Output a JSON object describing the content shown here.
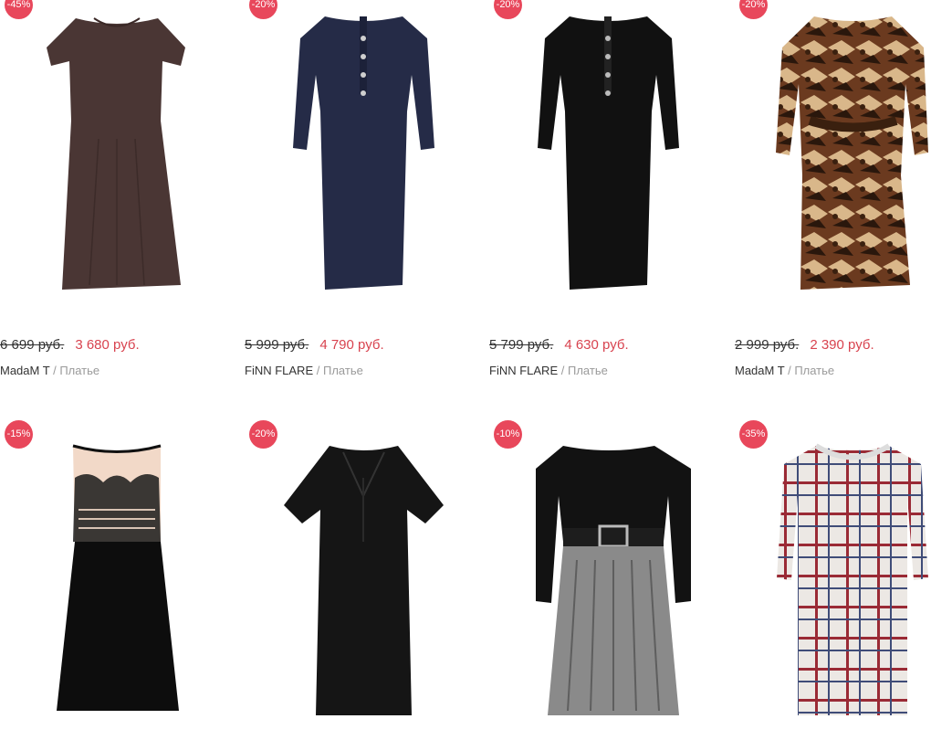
{
  "products": [
    {
      "badge": "-45%",
      "old_price": "6 699 руб.",
      "new_price": "3 680 руб.",
      "brand": "MadaM T",
      "category": "Платье"
    },
    {
      "badge": "-20%",
      "old_price": "5 999 руб.",
      "new_price": "4 790 руб.",
      "brand": "FiNN FLARE",
      "category": "Платье"
    },
    {
      "badge": "-20%",
      "old_price": "5 799 руб.",
      "new_price": "4 630 руб.",
      "brand": "FiNN FLARE",
      "category": "Платье"
    },
    {
      "badge": "-20%",
      "old_price": "2 999 руб.",
      "new_price": "2 390 руб.",
      "brand": "MadaM T",
      "category": "Платье"
    },
    {
      "badge": "-15%"
    },
    {
      "badge": "-20%"
    },
    {
      "badge": "-10%"
    },
    {
      "badge": "-35%"
    }
  ],
  "separator": "/",
  "colors": {
    "badge": "#e8475b",
    "new_price": "#d8434f",
    "category": "#9a9a9a"
  }
}
